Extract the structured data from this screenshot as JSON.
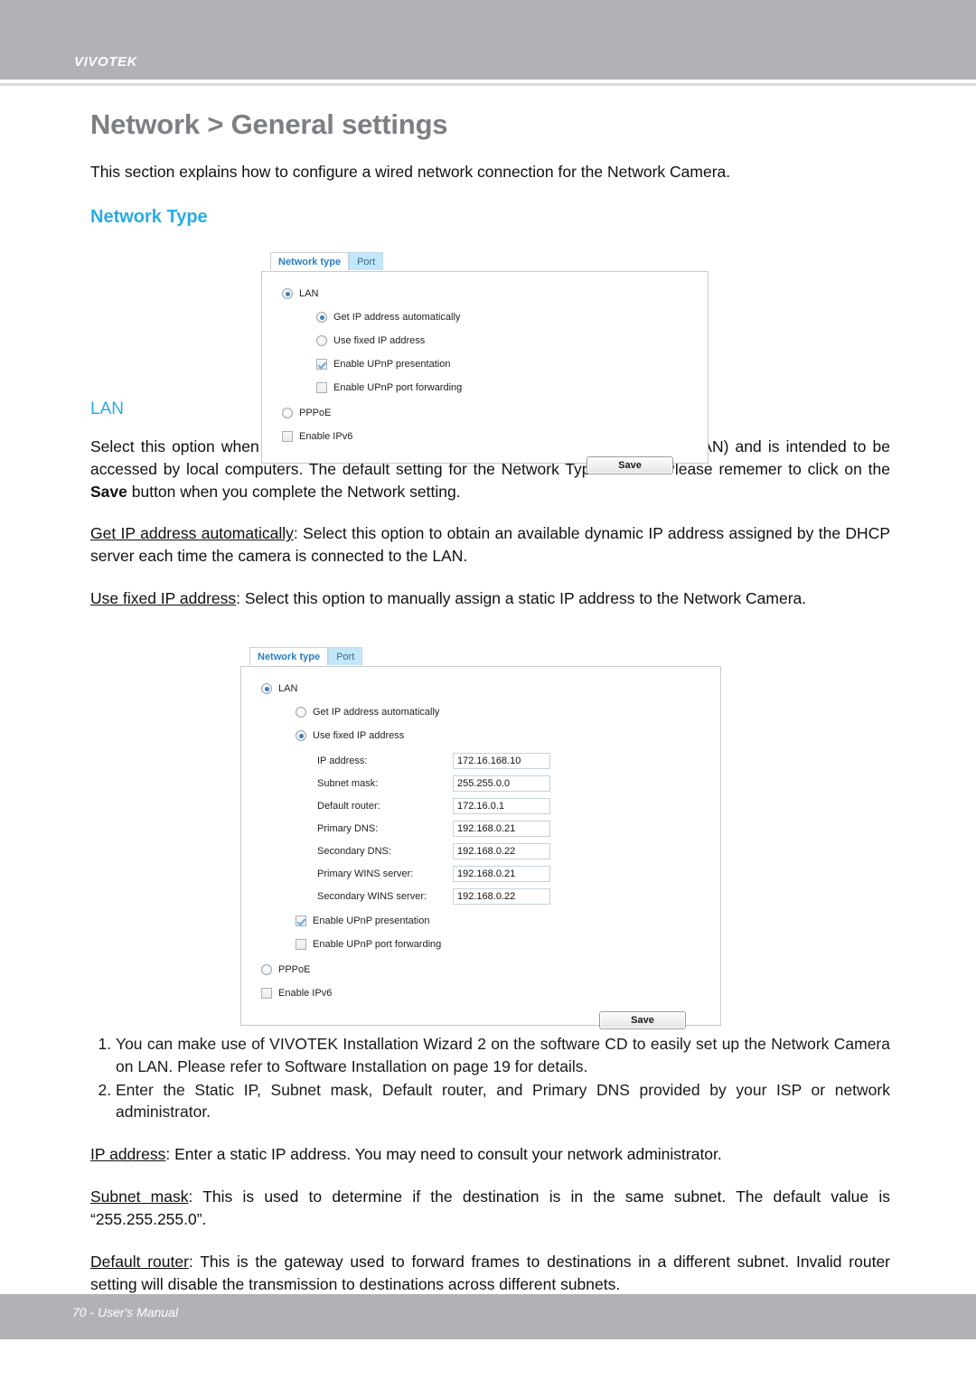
{
  "header": {
    "brand": "VIVOTEK"
  },
  "footer": {
    "text": "70 - User's Manual"
  },
  "page": {
    "title": "Network > General settings",
    "intro": "This section explains how to configure a wired network connection for the Network Camera.",
    "network_type_heading": "Network Type",
    "lan_heading": "LAN",
    "lan_paragraph_1": "Select this option when the Network Camera is deployed on a local area network (LAN) and is intended to be accessed by local computers. The default setting for the Network Type is LAN. Please rememer to click on the ",
    "lan_paragraph_save": "Save",
    "lan_paragraph_2": " button when you complete the Network setting.",
    "get_ip_term": "Get IP address automatically",
    "get_ip_desc": ": Select this option to obtain an available dynamic IP address assigned by the DHCP server each time the camera is connected to the LAN.",
    "use_fixed_term": "Use fixed IP address",
    "use_fixed_desc": ": Select this option to manually assign a static IP address to the Network Camera.",
    "numbered_items": [
      "You can make use of VIVOTEK Installation Wizard 2 on the software CD to easily set up the Network Camera on LAN. Please refer to Software Installation on page 19 for details.",
      "Enter the Static IP, Subnet mask, Default router, and Primary DNS provided by your ISP or network administrator."
    ],
    "ip_address_term": "IP address",
    "ip_address_desc": ": Enter a static IP address. You may need to consult your network administrator.",
    "subnet_mask_term": "Subnet mask",
    "subnet_mask_desc": ": This is used to determine if the destination is in the same subnet. The default value is “255.255.255.0”.",
    "default_router_term": "Default router",
    "default_router_desc": ": This is the gateway used to forward frames to destinations in a different subnet. Invalid router setting will disable the transmission to destinations across different subnets."
  },
  "widget_top": {
    "tabs": [
      {
        "label": "Network type",
        "active": true
      },
      {
        "label": "Port",
        "active": false
      }
    ],
    "lan_label": "LAN",
    "lan_selected": true,
    "options": [
      {
        "label": "Get IP address automatically",
        "type": "radio",
        "checked": true
      },
      {
        "label": "Use fixed IP address",
        "type": "radio",
        "checked": false
      },
      {
        "label": "Enable UPnP presentation",
        "type": "checkbox",
        "checked": true
      },
      {
        "label": "Enable UPnP port forwarding",
        "type": "checkbox",
        "checked": false
      }
    ],
    "pppoe_label": "PPPoE",
    "pppoe_selected": false,
    "ipv6_label": "Enable IPv6",
    "ipv6_checked": false,
    "save_label": "Save"
  },
  "widget_bottom": {
    "tabs": [
      {
        "label": "Network type",
        "active": true
      },
      {
        "label": "Port",
        "active": false
      }
    ],
    "lan_label": "LAN",
    "lan_selected": true,
    "radio_auto": {
      "label": "Get IP address automatically",
      "checked": false
    },
    "radio_fixed": {
      "label": "Use fixed IP address",
      "checked": true
    },
    "fields": [
      {
        "label": "IP address:",
        "value": "172.16.168.10"
      },
      {
        "label": "Subnet mask:",
        "value": "255.255.0.0"
      },
      {
        "label": "Default router:",
        "value": "172.16.0.1"
      },
      {
        "label": "Primary DNS:",
        "value": "192.168.0.21"
      },
      {
        "label": "Secondary DNS:",
        "value": "192.168.0.22"
      },
      {
        "label": "Primary WINS server:",
        "value": "192.168.0.21"
      },
      {
        "label": "Secondary WINS server:",
        "value": "192.168.0.22"
      }
    ],
    "checkboxes": [
      {
        "label": "Enable UPnP presentation",
        "checked": true
      },
      {
        "label": "Enable UPnP port forwarding",
        "checked": false
      }
    ],
    "pppoe_label": "PPPoE",
    "pppoe_selected": false,
    "ipv6_label": "Enable IPv6",
    "ipv6_checked": false,
    "save_label": "Save"
  },
  "colors": {
    "chrome_gray": "#b0b2b6",
    "title_gray": "#7c7f83",
    "accent_blue": "#2aabe2",
    "tab_active_text": "#2a7fc0",
    "tab_inactive_bg": "#c3e7fa"
  }
}
